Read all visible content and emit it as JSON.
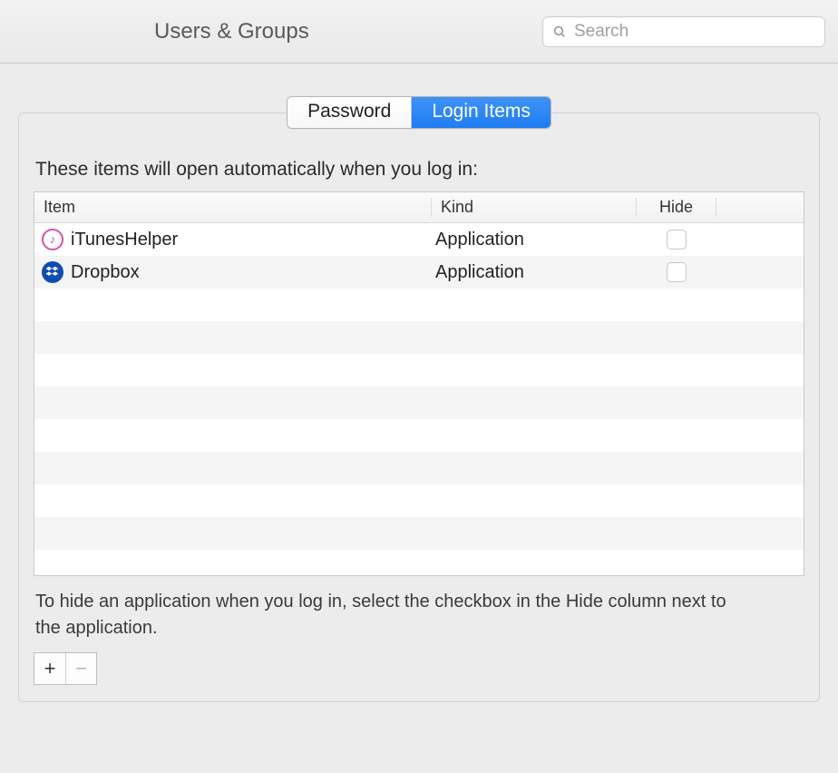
{
  "header": {
    "title": "Users & Groups",
    "search_placeholder": "Search"
  },
  "tabs": {
    "password": "Password",
    "login_items": "Login Items",
    "active": "login_items"
  },
  "login_items": {
    "intro": "These items will open automatically when you log in:",
    "columns": {
      "item": "Item",
      "kind": "Kind",
      "hide": "Hide"
    },
    "rows": [
      {
        "icon": "itunes",
        "name": "iTunesHelper",
        "kind": "Application",
        "hide": false
      },
      {
        "icon": "dropbox",
        "name": "Dropbox",
        "kind": "Application",
        "hide": false
      }
    ],
    "empty_row_count": 9,
    "hint": "To hide an application when you log in, select the checkbox in the Hide column next to the application.",
    "buttons": {
      "add": "+",
      "remove": "−",
      "remove_enabled": false
    }
  }
}
